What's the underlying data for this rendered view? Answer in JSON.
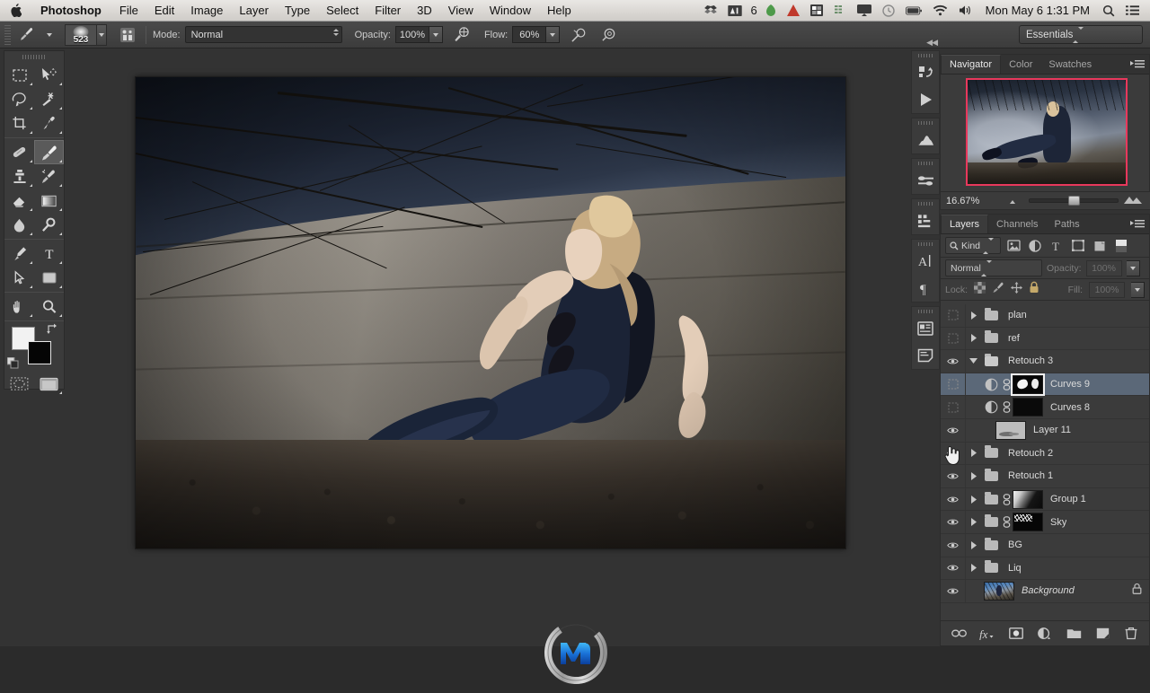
{
  "menubar": {
    "apple_icon": "apple-logo",
    "items": [
      {
        "label": "Photoshop",
        "bold": true
      },
      {
        "label": "File"
      },
      {
        "label": "Edit"
      },
      {
        "label": "Image"
      },
      {
        "label": "Layer"
      },
      {
        "label": "Type"
      },
      {
        "label": "Select"
      },
      {
        "label": "Filter"
      },
      {
        "label": "3D"
      },
      {
        "label": "View"
      },
      {
        "label": "Window"
      },
      {
        "label": "Help"
      }
    ],
    "status_icons": [
      "dropbox-icon",
      "photos-badge-icon",
      "6",
      "evernote-icon",
      "crashplan-icon",
      "grid-icon",
      "equalizer-icon",
      "airplay-icon",
      "timemachine-icon",
      "battery-icon",
      "wifi-icon",
      "volume-icon"
    ],
    "badge_count": "6",
    "clock": "Mon May 6  1:31 PM",
    "search_icon": "search-icon",
    "notification_icon": "notification-center-icon"
  },
  "options_bar": {
    "tool_icon": "brush-tool-icon",
    "brush_size": "523",
    "brush_panel_icon": "toggle-brush-panel-icon",
    "mode_label": "Mode:",
    "mode_value": "Normal",
    "opacity_label": "Opacity:",
    "opacity_value": "100%",
    "airbrush_icon": "airbrush-icon",
    "flow_label": "Flow:",
    "flow_value": "60%",
    "tablet_opacity_icon": "tablet-pressure-opacity-icon",
    "tablet_size_icon": "tablet-pressure-size-icon",
    "workspace": "Essentials"
  },
  "toolbox": {
    "tools": [
      {
        "name": "marquee-tool",
        "selected": false
      },
      {
        "name": "move-tool",
        "selected": false
      },
      {
        "name": "lasso-tool",
        "selected": false
      },
      {
        "name": "magic-wand-tool",
        "selected": false
      },
      {
        "name": "crop-tool",
        "selected": false
      },
      {
        "name": "eyedropper-tool",
        "selected": false
      },
      {
        "name": "healing-brush-tool",
        "selected": false
      },
      {
        "name": "brush-tool",
        "selected": true
      },
      {
        "name": "clone-stamp-tool",
        "selected": false
      },
      {
        "name": "history-brush-tool",
        "selected": false
      },
      {
        "name": "eraser-tool",
        "selected": false
      },
      {
        "name": "gradient-tool",
        "selected": false
      },
      {
        "name": "blur-tool",
        "selected": false
      },
      {
        "name": "dodge-tool",
        "selected": false
      },
      {
        "name": "pen-tool",
        "selected": false
      },
      {
        "name": "type-tool",
        "selected": false
      },
      {
        "name": "path-selection-tool",
        "selected": false
      },
      {
        "name": "shape-tool",
        "selected": false
      },
      {
        "name": "hand-tool",
        "selected": false
      },
      {
        "name": "zoom-tool",
        "selected": false
      }
    ],
    "foreground_color": "#f2f2f2",
    "background_color": "#050505",
    "swap_icon": "swap-colors-icon",
    "default_colors_icon": "default-colors-icon",
    "quickmask_icon": "quick-mask-icon",
    "screenmode_icon": "screen-mode-icon"
  },
  "dock": {
    "collapse_icon": "collapse-panels-icon",
    "buttons": [
      "history-icon",
      "actions-icon",
      "histogram-icon",
      "adjustments-icon",
      "styles-icon",
      "character-icon",
      "paragraph-icon",
      "notes-icon",
      "properties-icon"
    ]
  },
  "navigator": {
    "tabs": [
      {
        "label": "Navigator",
        "active": true
      },
      {
        "label": "Color",
        "active": false
      },
      {
        "label": "Swatches",
        "active": false
      }
    ],
    "menu_icon": "panel-menu-icon",
    "zoom_level": "16.67%",
    "view_box_color": "#e8385c",
    "zoom_out_icon": "zoom-out-icon",
    "zoom_in_icon": "zoom-in-icon"
  },
  "layers_panel": {
    "tabs": [
      {
        "label": "Layers",
        "active": true
      },
      {
        "label": "Channels",
        "active": false
      },
      {
        "label": "Paths",
        "active": false
      }
    ],
    "menu_icon": "panel-menu-icon",
    "filter": {
      "search_icon": "search-icon",
      "kind_label": "Kind",
      "icons": [
        "filter-pixel-icon",
        "filter-adjustment-icon",
        "filter-type-icon",
        "filter-shape-icon",
        "filter-smartobject-icon",
        "filter-toggle-icon"
      ]
    },
    "blend_mode": "Normal",
    "opacity_label": "Opacity:",
    "opacity_value": "100%",
    "lock_label": "Lock:",
    "lock_icons": [
      "lock-transparency-icon",
      "lock-image-icon",
      "lock-position-icon",
      "lock-all-icon"
    ],
    "fill_label": "Fill:",
    "fill_value": "100%",
    "layers": [
      {
        "name": "plan",
        "visible": false,
        "type": "group",
        "expanded": false,
        "selected": false
      },
      {
        "name": "ref",
        "visible": false,
        "type": "group",
        "expanded": false,
        "selected": false
      },
      {
        "name": "Retouch 3",
        "visible": true,
        "type": "group",
        "expanded": true,
        "selected": false
      },
      {
        "name": "Curves 9",
        "visible": false,
        "type": "adjustment",
        "child": true,
        "selected": true,
        "mask": "light",
        "mask_selected": true,
        "linked": true
      },
      {
        "name": "Curves 8",
        "visible": false,
        "type": "adjustment",
        "child": true,
        "selected": false,
        "mask": "dark",
        "mask_selected": false,
        "linked": true
      },
      {
        "name": "Layer 11",
        "visible": true,
        "type": "pixel",
        "child": true,
        "selected": false
      },
      {
        "name": "Retouch 2",
        "visible": true,
        "type": "group",
        "expanded": false,
        "selected": false
      },
      {
        "name": "Retouch 1",
        "visible": true,
        "type": "group",
        "expanded": false,
        "selected": false
      },
      {
        "name": "Group 1",
        "visible": true,
        "type": "group",
        "expanded": false,
        "selected": false,
        "mask": "gradient",
        "linked": true
      },
      {
        "name": "Sky",
        "visible": true,
        "type": "group",
        "expanded": false,
        "selected": false,
        "mask": "speckle",
        "linked": true
      },
      {
        "name": "BG",
        "visible": true,
        "type": "group",
        "expanded": false,
        "selected": false
      },
      {
        "name": "Liq",
        "visible": true,
        "type": "group",
        "expanded": false,
        "selected": false
      },
      {
        "name": "Background",
        "visible": true,
        "type": "pixel",
        "selected": false,
        "italic": true,
        "locked": true
      }
    ],
    "footer_buttons": [
      "link-layers-icon",
      "layer-style-fx-icon",
      "add-mask-icon",
      "adjustment-layer-icon",
      "new-group-icon",
      "new-layer-icon",
      "delete-layer-icon"
    ]
  },
  "document": {
    "zoom": "16.67%",
    "canvas_description": "photo-composite-model-against-concrete-wall"
  },
  "cursor": {
    "icon": "pointing-hand-cursor"
  },
  "watermark": {
    "icon": "circle-m-logo"
  }
}
